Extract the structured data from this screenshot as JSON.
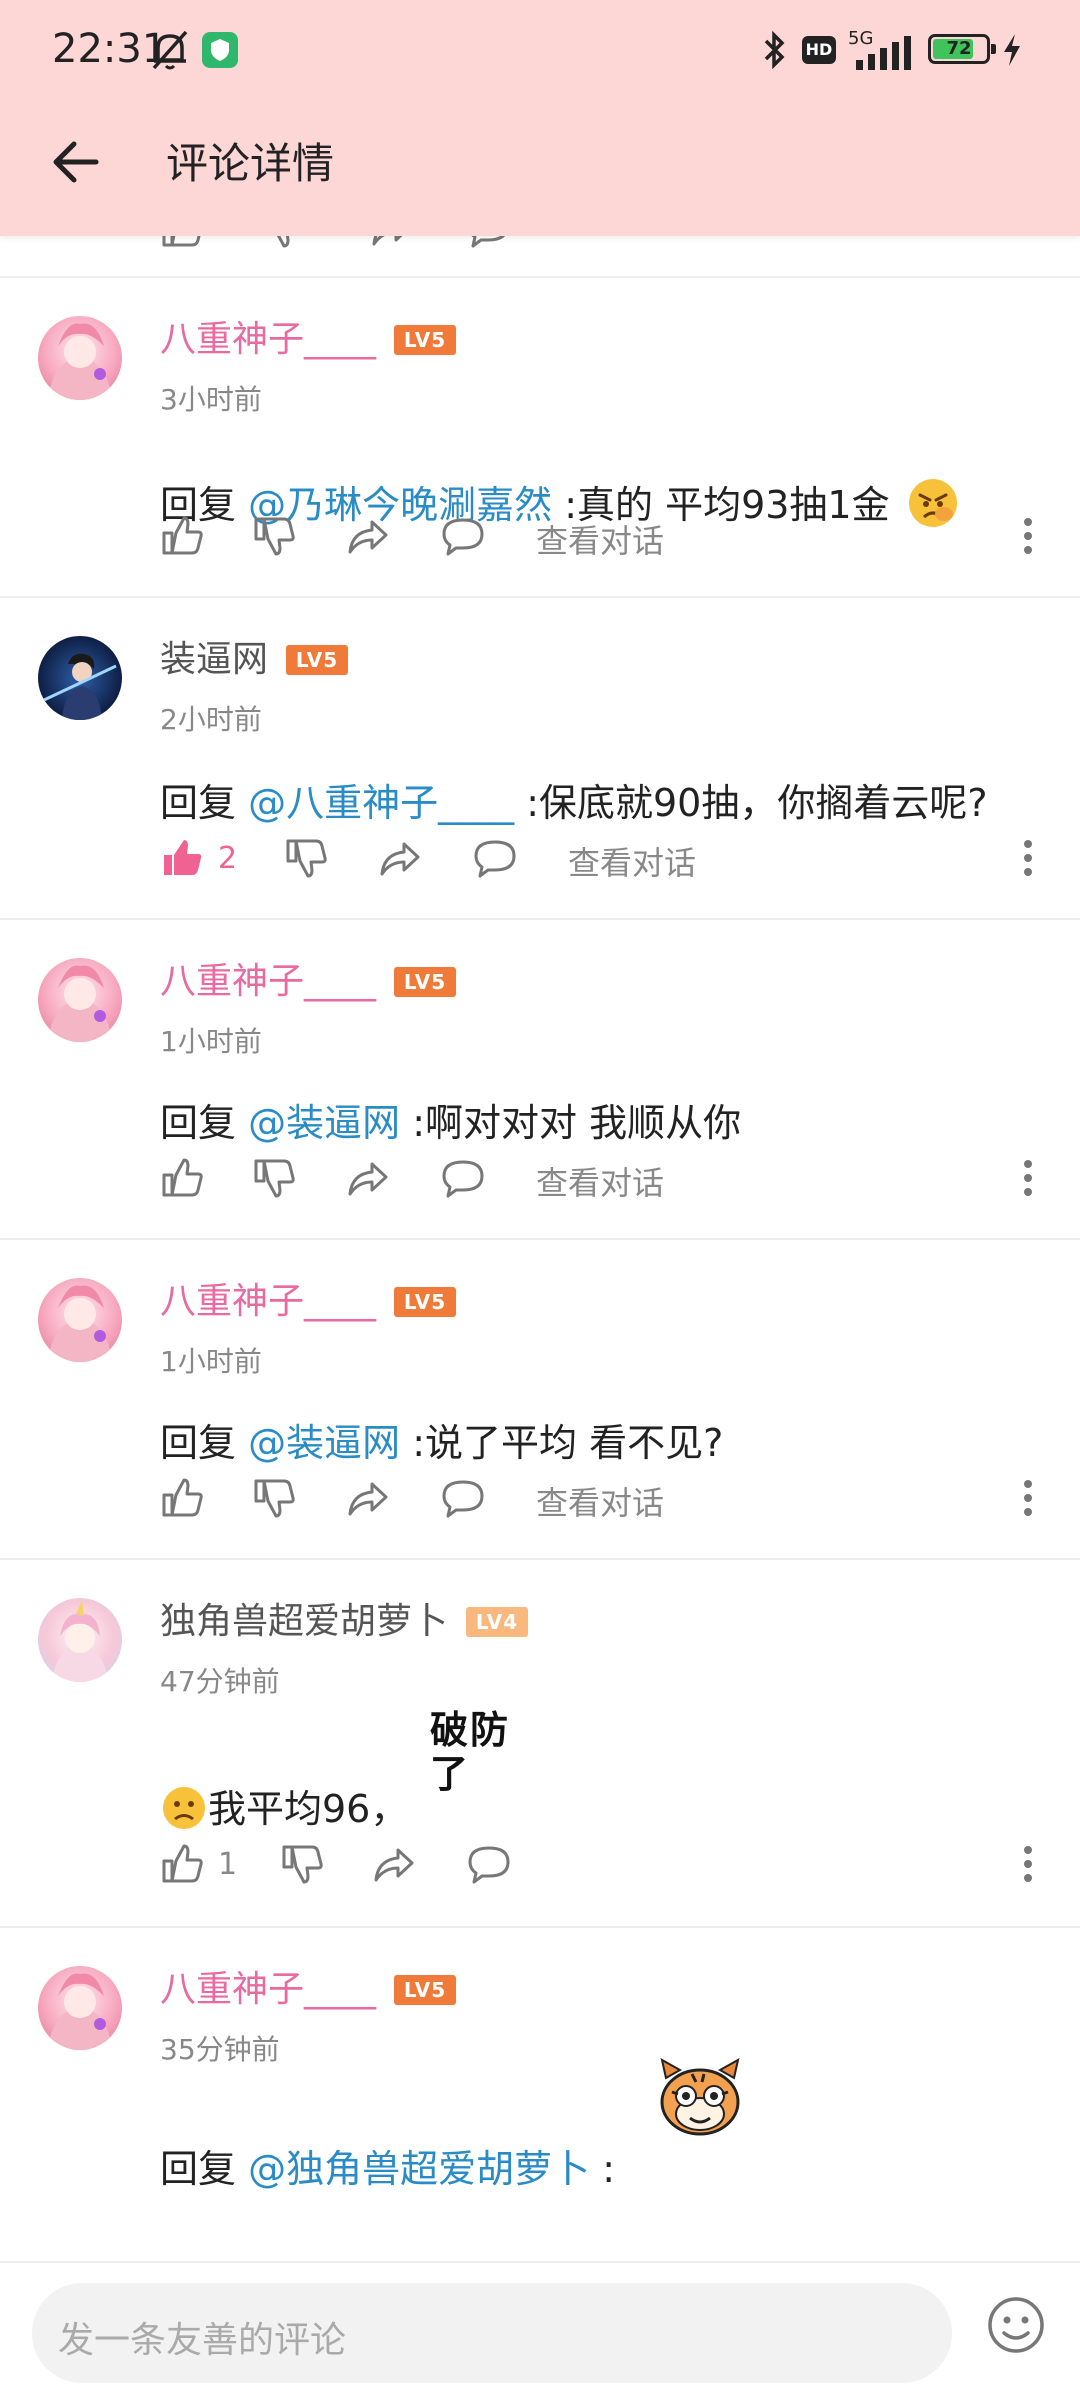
{
  "status_bar": {
    "time": "22:31",
    "battery": "72",
    "network": "5G",
    "hd": "HD"
  },
  "nav": {
    "title": "评论详情"
  },
  "comments": [
    {
      "username": "八重神子____",
      "level": "LV5",
      "time": "3小时前",
      "reply_prefix": "回复 ",
      "mention": "@乃琳今晚涮嘉然",
      "text": " :真的 平均93抽1金",
      "like_count": "",
      "view_conversation": "查看对话"
    },
    {
      "username": "装逼网",
      "level": "LV5",
      "time": "2小时前",
      "reply_prefix": "回复 ",
      "mention": "@八重神子____",
      "text": " :保底就90抽，你搁着云呢?",
      "like_count": "2",
      "view_conversation": "查看对话"
    },
    {
      "username": "八重神子____",
      "level": "LV5",
      "time": "1小时前",
      "reply_prefix": "回复 ",
      "mention": "@装逼网",
      "text": " :啊对对对 我顺从你",
      "like_count": "",
      "view_conversation": "查看对话"
    },
    {
      "username": "八重神子____",
      "level": "LV5",
      "time": "1小时前",
      "reply_prefix": "回复 ",
      "mention": "@装逼网",
      "text": " :说了平均 看不见?",
      "like_count": "",
      "view_conversation": "查看对话"
    },
    {
      "username": "独角兽超爱胡萝卜",
      "level": "LV4",
      "time": "47分钟前",
      "text": "我平均96，",
      "sticker_text": "破防了",
      "like_count": "1"
    },
    {
      "username": "八重神子____",
      "level": "LV5",
      "time": "35分钟前",
      "reply_prefix": "回复 ",
      "mention": "@独角兽超爱胡萝卜",
      "text": " :"
    }
  ],
  "input": {
    "placeholder": "发一条友善的评论"
  },
  "colors": {
    "header_bg": "#fdd6d6",
    "vip_name": "#e86aa0",
    "mention": "#2a8cc6",
    "lv5": "#ef7a3a",
    "lv4": "#f9b97e",
    "liked": "#f06292"
  },
  "icons": [
    "back-arrow-icon",
    "bell-off-icon",
    "shield-app-icon",
    "bluetooth-icon",
    "signal-icon",
    "battery-icon",
    "charging-icon",
    "thumbs-up-icon",
    "thumbs-down-icon",
    "share-icon",
    "comment-icon",
    "more-vertical-icon",
    "emoji-icon"
  ]
}
